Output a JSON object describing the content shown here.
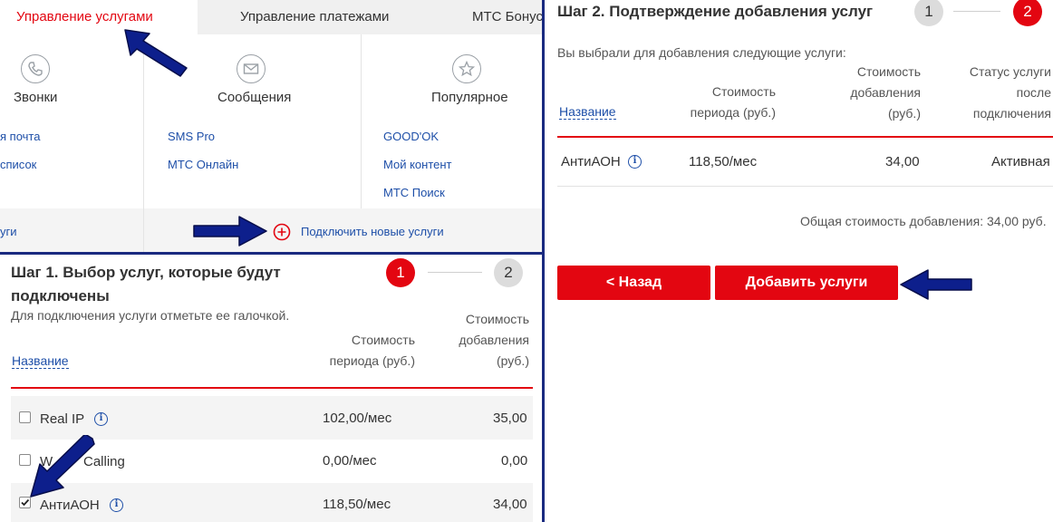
{
  "tabs": {
    "manage_services": "Управление услугами",
    "manage_payments": "Управление платежами",
    "mts_bonus": "МТС Бонус"
  },
  "categories": {
    "calls": "Звонки",
    "messages": "Сообщения",
    "popular": "Популярное"
  },
  "links": {
    "col1": [
      "я почта",
      "список"
    ],
    "col2": [
      "SMS Pro",
      "МТС Онлайн"
    ],
    "col3": [
      "GOOD'OK",
      "Мой контент",
      "МТС Поиск"
    ]
  },
  "graybar": {
    "left_fragment": "уги",
    "connect_new": "Подключить новые услуги"
  },
  "step1": {
    "title_line1": "Шаг 1. Выбор услуг, которые будут",
    "title_line2": "подключены",
    "badge_active": "1",
    "badge_next": "2",
    "note": "Для подключения услуги отметьте ее галочкой.",
    "col_name": "Название",
    "col_period": [
      "Стоимость",
      "периода (руб.)"
    ],
    "col_add": [
      "Стоимость",
      "добавления",
      "(руб.)"
    ],
    "rows": [
      {
        "name": "Real IP",
        "period": "102,00/мес",
        "add": "35,00",
        "checked": false
      },
      {
        "name_visible": "W",
        "name_tail": "Calling",
        "period": "0,00/мес",
        "add": "0,00",
        "checked": false
      },
      {
        "name": "АнтиАОН",
        "period": "118,50/мес",
        "add": "34,00",
        "checked": true
      }
    ]
  },
  "step2": {
    "title": "Шаг 2. Подтверждение добавления услуг",
    "badge_prev": "1",
    "badge_active": "2",
    "note": "Вы выбрали для добавления следующие услуги:",
    "col_name": "Название",
    "col_period": [
      "Стоимость",
      "периода (руб.)"
    ],
    "col_add": [
      "Стоимость",
      "добавления",
      "(руб.)"
    ],
    "col_status": [
      "Статус услуги",
      "после",
      "подключения"
    ],
    "row": {
      "name": "АнтиАОН",
      "period": "118,50/мес",
      "add": "34,00",
      "status": "Активная"
    },
    "total": "Общая стоимость добавления: 34,00 руб.",
    "back_button": "< Назад",
    "add_button": "Добавить услуги"
  },
  "colors": {
    "brand_red": "#e30611",
    "link_blue": "#1e4fa8",
    "annotation_navy": "#0d1f8c"
  }
}
